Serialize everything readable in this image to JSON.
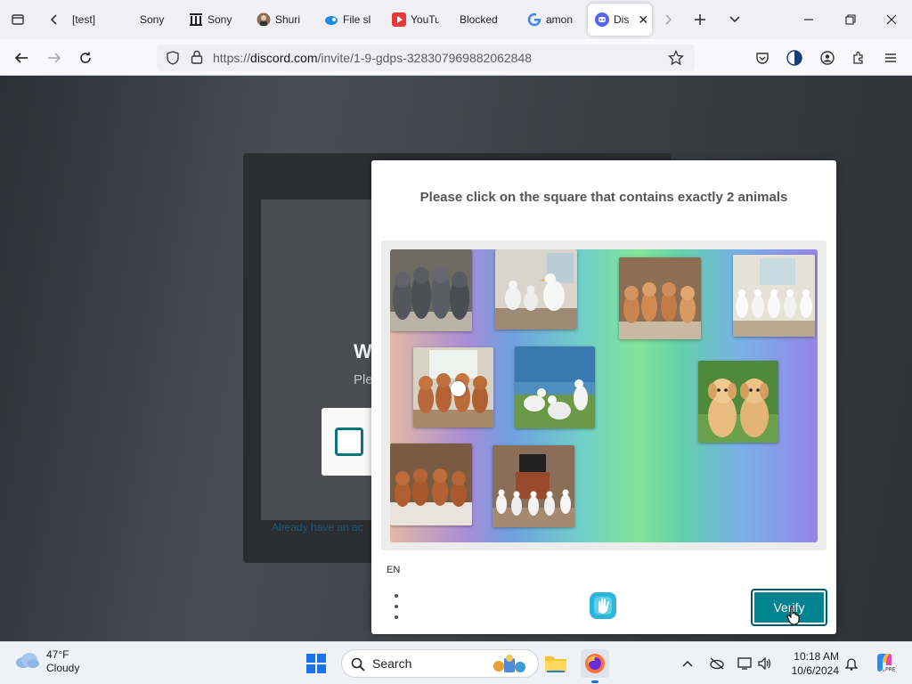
{
  "browser": {
    "tabs": [
      {
        "label": "[test]",
        "favicon": "generic-page"
      },
      {
        "label": "Sony",
        "favicon": "none"
      },
      {
        "label": "Sony",
        "favicon": "library-columns"
      },
      {
        "label": "Shuri",
        "favicon": "avatar"
      },
      {
        "label": "File sl",
        "favicon": "bird-logo"
      },
      {
        "label": "YouTu",
        "favicon": "youtube-music"
      },
      {
        "label": "Blocked",
        "favicon": "none"
      },
      {
        "label": "amon",
        "favicon": "google-g"
      },
      {
        "label": "Dis",
        "favicon": "discord-logo"
      }
    ],
    "url_prefix": "https://",
    "url_domain": "discord.com",
    "url_path": "/invite/1-9-gdps-328307969882062848"
  },
  "discord": {
    "heading_partial": "W",
    "subtext_partial": "Ple",
    "link_partial": "Already have an ac"
  },
  "captcha": {
    "prompt": "Please click on the square that contains exactly 2 animals",
    "language": "EN",
    "verify_label": "Verify",
    "accent_color": "#00838f",
    "tiles": [
      {
        "subject": "dogs",
        "count": 4
      },
      {
        "subject": "seagulls",
        "count": 3
      },
      {
        "subject": "dogs",
        "count": 4
      },
      {
        "subject": "seagulls",
        "count": 5
      },
      {
        "subject": "dogs",
        "count": 4
      },
      {
        "subject": "seagulls",
        "count": 3
      },
      {
        "subject": "dogs",
        "count": 2
      },
      {
        "subject": "dogs",
        "count": 4
      },
      {
        "subject": "seagulls",
        "count": 5
      }
    ]
  },
  "taskbar": {
    "weather_temp": "47°F",
    "weather_desc": "Cloudy",
    "search_label": "Search",
    "time": "10:18 AM",
    "date": "10/6/2024"
  }
}
